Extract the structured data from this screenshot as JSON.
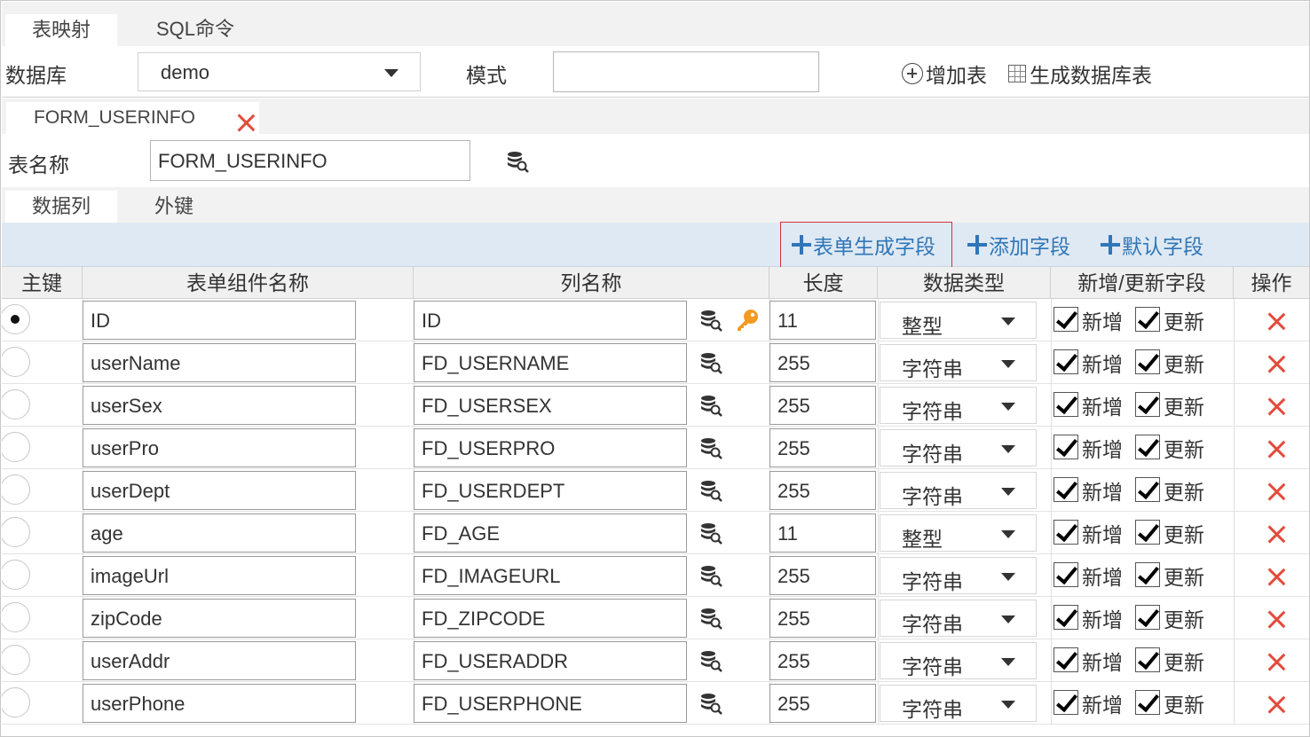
{
  "top_tabs": {
    "map": "表映射",
    "sql": "SQL命令"
  },
  "db_row": {
    "db_label": "数据库",
    "db_value": "demo",
    "mode_label": "模式",
    "mode_value": "",
    "add_table": "增加表",
    "gen_table": "生成数据库表"
  },
  "table_tab": {
    "name": "FORM_USERINFO"
  },
  "table_name": {
    "label": "表名称",
    "value": "FORM_USERINFO"
  },
  "sub_tabs": {
    "columns": "数据列",
    "fk": "外键"
  },
  "toolbar": {
    "gen_from_form": "表单生成字段",
    "add_field": "添加字段",
    "default_field": "默认字段"
  },
  "headers": {
    "pk": "主键",
    "component": "表单组件名称",
    "column": "列名称",
    "length": "长度",
    "dtype": "数据类型",
    "insert_update": "新增/更新字段",
    "action": "操作"
  },
  "labels": {
    "insert": "新增",
    "update": "更新"
  },
  "colors": {
    "accent": "#2f76b8",
    "delete": "#e24b3b",
    "highlight": "#d9303b",
    "toolbar_bg": "#dfe9f3"
  },
  "rows": [
    {
      "pk": true,
      "component": "ID",
      "column": "ID",
      "length": "11",
      "type": "整型",
      "key_icon": true
    },
    {
      "pk": false,
      "component": "userName",
      "column": "FD_USERNAME",
      "length": "255",
      "type": "字符串",
      "key_icon": false
    },
    {
      "pk": false,
      "component": "userSex",
      "column": "FD_USERSEX",
      "length": "255",
      "type": "字符串",
      "key_icon": false
    },
    {
      "pk": false,
      "component": "userPro",
      "column": "FD_USERPRO",
      "length": "255",
      "type": "字符串",
      "key_icon": false
    },
    {
      "pk": false,
      "component": "userDept",
      "column": "FD_USERDEPT",
      "length": "255",
      "type": "字符串",
      "key_icon": false
    },
    {
      "pk": false,
      "component": "age",
      "column": "FD_AGE",
      "length": "11",
      "type": "整型",
      "key_icon": false
    },
    {
      "pk": false,
      "component": "imageUrl",
      "column": "FD_IMAGEURL",
      "length": "255",
      "type": "字符串",
      "key_icon": false
    },
    {
      "pk": false,
      "component": "zipCode",
      "column": "FD_ZIPCODE",
      "length": "255",
      "type": "字符串",
      "key_icon": false
    },
    {
      "pk": false,
      "component": "userAddr",
      "column": "FD_USERADDR",
      "length": "255",
      "type": "字符串",
      "key_icon": false
    },
    {
      "pk": false,
      "component": "userPhone",
      "column": "FD_USERPHONE",
      "length": "255",
      "type": "字符串",
      "key_icon": false
    }
  ]
}
